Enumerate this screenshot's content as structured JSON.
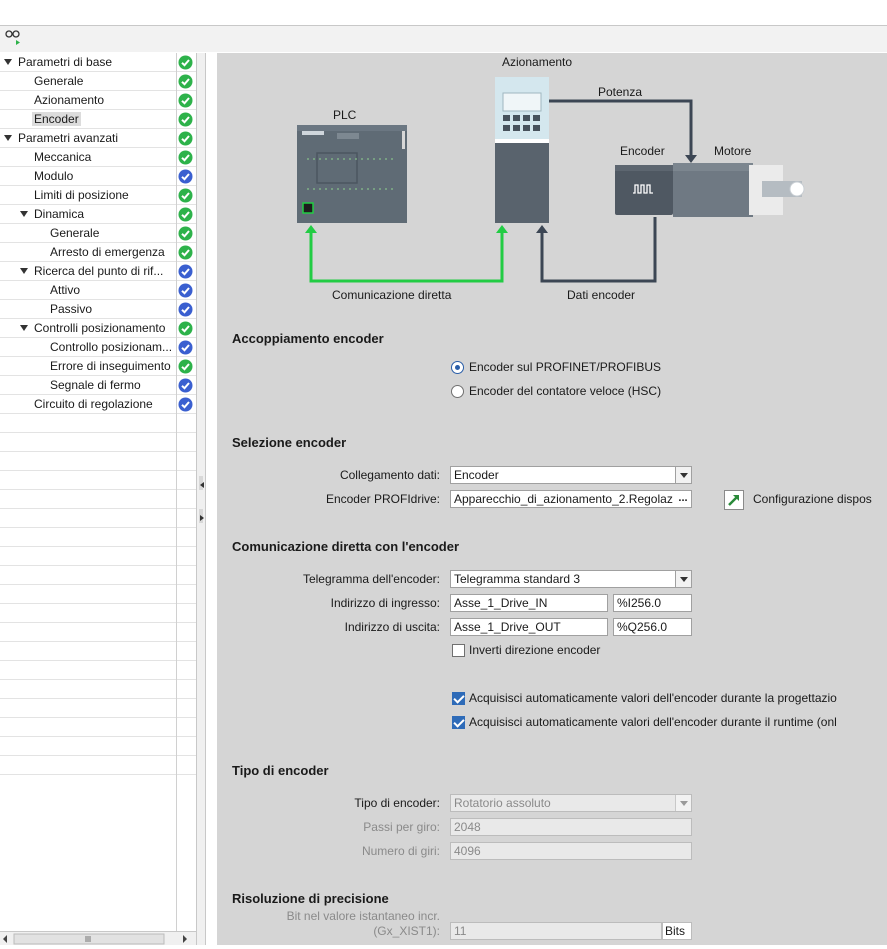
{
  "tree": {
    "items": [
      {
        "label": "Parametri di base",
        "status": "ok"
      },
      {
        "label": "Generale",
        "status": "ok"
      },
      {
        "label": "Azionamento",
        "status": "ok"
      },
      {
        "label": "Encoder",
        "status": "ok"
      },
      {
        "label": "Parametri avanzati",
        "status": "ok"
      },
      {
        "label": "Meccanica",
        "status": "ok"
      },
      {
        "label": "Modulo",
        "status": "info"
      },
      {
        "label": "Limiti di posizione",
        "status": "ok"
      },
      {
        "label": "Dinamica",
        "status": "ok"
      },
      {
        "label": "Generale",
        "status": "ok"
      },
      {
        "label": "Arresto di emergenza",
        "status": "ok"
      },
      {
        "label": "Ricerca del punto di rif...",
        "status": "info"
      },
      {
        "label": "Attivo",
        "status": "info"
      },
      {
        "label": "Passivo",
        "status": "info"
      },
      {
        "label": "Controlli posizionamento",
        "status": "ok"
      },
      {
        "label": "Controllo posizionam...",
        "status": "info"
      },
      {
        "label": "Errore di inseguimento",
        "status": "ok"
      },
      {
        "label": "Segnale di fermo",
        "status": "info"
      },
      {
        "label": "Circuito di regolazione",
        "status": "info"
      }
    ]
  },
  "diagram": {
    "plc": "PLC",
    "drive": "Azionamento",
    "power": "Potenza",
    "encoder": "Encoder",
    "motor": "Motore",
    "direct_comm": "Comunicazione diretta",
    "encoder_data": "Dati encoder"
  },
  "coupling": {
    "title": "Accoppiamento encoder",
    "options": [
      "Encoder sul PROFINET/PROFIBUS",
      "Encoder del contatore veloce (HSC)"
    ],
    "selected": 0
  },
  "selection": {
    "title": "Selezione encoder",
    "data_link_label": "Collegamento dati:",
    "data_link_value": "Encoder",
    "profidrive_label": "Encoder PROFIdrive:",
    "profidrive_value": "Apparecchio_di_azionamento_2.Regolaz",
    "profidrive_btn": "...",
    "config_link": "Configurazione dispos"
  },
  "direct": {
    "title": "Comunicazione diretta con l'encoder",
    "telegram_label": "Telegramma dell'encoder:",
    "telegram_value": "Telegramma standard 3",
    "in_label": "Indirizzo di ingresso:",
    "in_name": "Asse_1_Drive_IN",
    "in_addr": "%I256.0",
    "out_label": "Indirizzo di uscita:",
    "out_name": "Asse_1_Drive_OUT",
    "out_addr": "%Q256.0",
    "invert_label": "Inverti direzione encoder",
    "invert_checked": false,
    "auto_design_label": "Acquisisci automaticamente valori dell'encoder durante la progettazio",
    "auto_design_checked": true,
    "auto_runtime_label": "Acquisisci automaticamente valori dell'encoder durante il runtime (onl",
    "auto_runtime_checked": true
  },
  "type": {
    "title": "Tipo di encoder",
    "type_label": "Tipo di encoder:",
    "type_value": "Rotatorio assoluto",
    "steps_label": "Passi per giro:",
    "steps_value": "2048",
    "turns_label": "Numero di giri:",
    "turns_value": "4096"
  },
  "resolution": {
    "title": "Risoluzione di precisione",
    "bits_label_1": "Bit nel valore istantaneo incr.",
    "bits_label_2": "(Gx_XIST1):",
    "bits_value": "11",
    "bits_unit": "Bits"
  },
  "colors": {
    "ok": "#2db24a",
    "info": "#3a5fd0",
    "green_line": "#22cc44",
    "dark_line": "#3c4654",
    "panel": "#d5d5d5"
  }
}
